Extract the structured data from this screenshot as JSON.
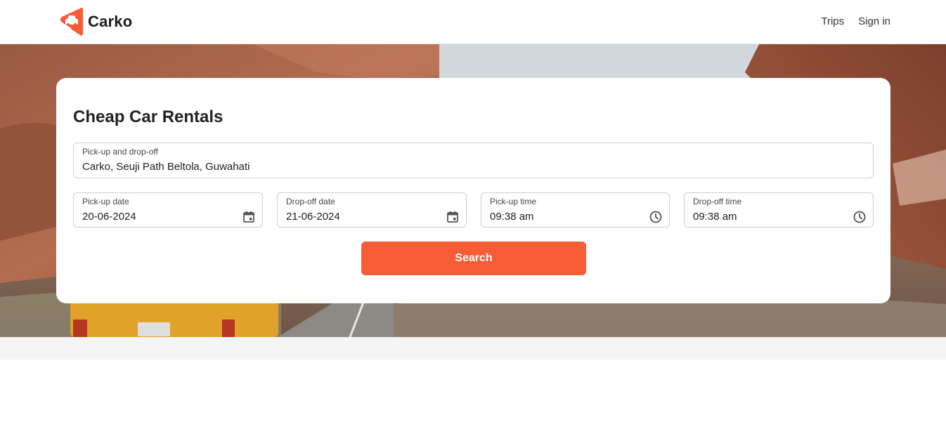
{
  "header": {
    "brand": "Carko",
    "brand_color": "#f65d36",
    "nav": {
      "trips": "Trips",
      "sign_in": "Sign in"
    }
  },
  "search_card": {
    "title": "Cheap Car Rentals",
    "location": {
      "label": "Pick-up and drop-off",
      "value": "Carko, Seuji Path Beltola, Guwahati"
    },
    "pickup_date": {
      "label": "Pick-up date",
      "value": "20-06-2024",
      "icon": "calendar-icon"
    },
    "dropoff_date": {
      "label": "Drop-off date",
      "value": "21-06-2024",
      "icon": "calendar-icon"
    },
    "pickup_time": {
      "label": "Pick-up time",
      "value": "09:38 am",
      "icon": "clock-icon"
    },
    "dropoff_time": {
      "label": "Drop-off time",
      "value": "09:38 am",
      "icon": "clock-icon"
    },
    "search_label": "Search",
    "button_color": "#f65d36"
  }
}
